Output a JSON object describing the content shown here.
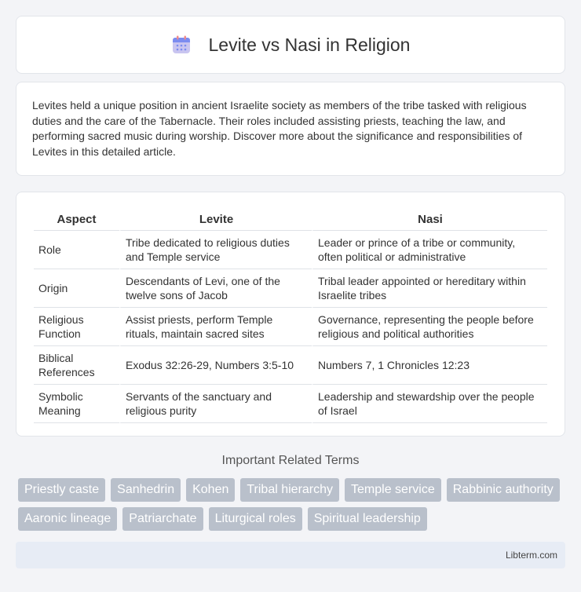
{
  "header": {
    "title": "Levite vs Nasi in Religion",
    "icon": "calendar-icon"
  },
  "intro": {
    "text": "Levites held a unique position in ancient Israelite society as members of the tribe tasked with religious duties and the care of the Tabernacle. Their roles included assisting priests, teaching the law, and performing sacred music during worship. Discover more about the significance and responsibilities of Levites in this detailed article."
  },
  "table": {
    "headers": [
      "Aspect",
      "Levite",
      "Nasi"
    ],
    "rows": [
      [
        "Role",
        "Tribe dedicated to religious duties and Temple service",
        "Leader or prince of a tribe or community, often political or administrative"
      ],
      [
        "Origin",
        "Descendants of Levi, one of the twelve sons of Jacob",
        "Tribal leader appointed or hereditary within Israelite tribes"
      ],
      [
        "Religious Function",
        "Assist priests, perform Temple rituals, maintain sacred sites",
        "Governance, representing the people before religious and political authorities"
      ],
      [
        "Biblical References",
        "Exodus 32:26-29, Numbers 3:5-10",
        "Numbers 7, 1 Chronicles 12:23"
      ],
      [
        "Symbolic Meaning",
        "Servants of the sanctuary and religious purity",
        "Leadership and stewardship over the people of Israel"
      ]
    ]
  },
  "related": {
    "title": "Important Related Terms",
    "tags": [
      "Priestly caste",
      "Sanhedrin",
      "Kohen",
      "Tribal hierarchy",
      "Temple service",
      "Rabbinic authority",
      "Aaronic lineage",
      "Patriarchate",
      "Liturgical roles",
      "Spiritual leadership"
    ]
  },
  "footer": {
    "text": "Libterm.com"
  }
}
